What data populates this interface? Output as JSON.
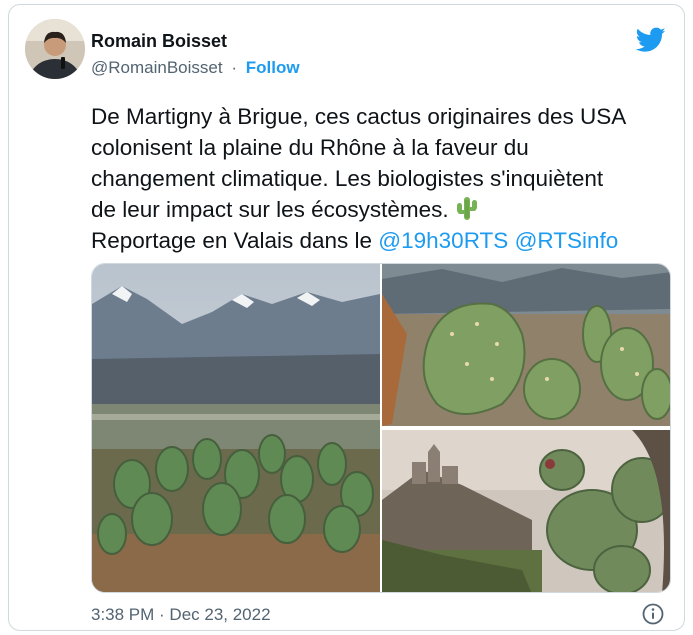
{
  "author": {
    "name": "Romain Boisset",
    "handle": "@RomainBoisset",
    "separator": "·",
    "follow_label": "Follow"
  },
  "tweet": {
    "lines": [
      "De Martigny à Brigue, ces cactus originaires des USA",
      "colonisent la plaine du Rhône à la faveur du",
      "changement climatique. Les biologistes s'inquiètent",
      "de leur impact sur les écosystèmes."
    ],
    "reportage_prefix": "Reportage en Valais dans le ",
    "mentions": [
      "@19h30RTS",
      "@RTSinfo"
    ],
    "emoji": "cactus-emoji"
  },
  "media": [
    {
      "icon": "photo-mountains-cactus"
    },
    {
      "icon": "photo-cactus-closeup"
    },
    {
      "icon": "photo-castle-cactus"
    }
  ],
  "footer": {
    "timestamp": "3:38 PM · Dec 23, 2022",
    "info_icon": "info-icon"
  },
  "colors": {
    "accent": "#1d9bf0",
    "text": "#0f1419",
    "muted": "#536471",
    "border": "#cfd9de"
  },
  "icons": {
    "brand": "twitter-bird-icon"
  }
}
